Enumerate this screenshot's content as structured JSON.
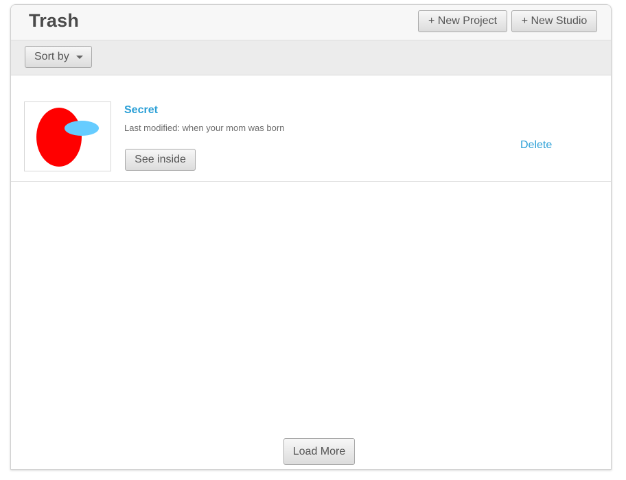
{
  "header": {
    "title": "Trash",
    "new_project_label": "+ New Project",
    "new_studio_label": "+ New Studio"
  },
  "toolbar": {
    "sort_label": "Sort by"
  },
  "projects": [
    {
      "title": "Secret",
      "meta": "Last modified: when your mom was born",
      "see_inside_label": "See inside",
      "delete_label": "Delete",
      "thumbnail": {
        "shapes": [
          "red-ellipse",
          "light-blue-ellipse"
        ],
        "colors": {
          "red": "#ff0000",
          "blue": "#66ccff"
        }
      }
    }
  ],
  "footer": {
    "load_more_label": "Load More"
  },
  "colors": {
    "link": "#2a9fd6",
    "title_text": "#4a4a4a",
    "header_bg": "#f7f7f7",
    "toolbar_bg": "#ececec"
  }
}
